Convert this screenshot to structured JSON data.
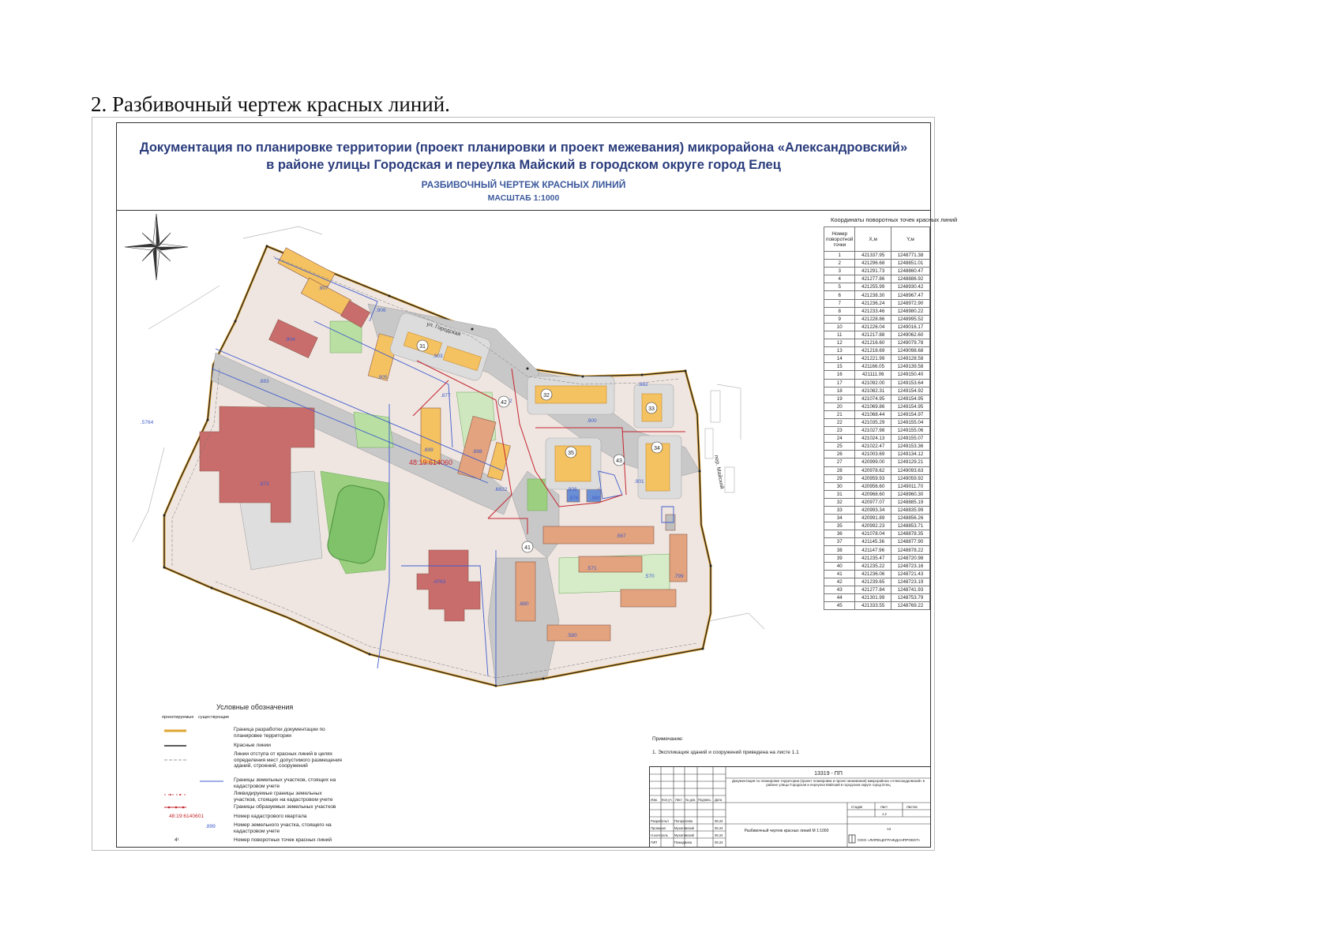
{
  "heading": "2. Разбивочный чертеж красных линий.",
  "title": {
    "line1": "Документация по планировке территории (проект планировки и проект межевания) микрорайона «Александровский»",
    "line2": "в районе улицы Городская и переулка Майский в городском округе город Елец",
    "subtitle": "РАЗБИВОЧНЫЙ ЧЕРТЕЖ КРАСНЫХ ЛИНИЙ",
    "scale": "МАСШТАБ 1:1000"
  },
  "map": {
    "cadastral_quarter": "48:19:614060",
    "street_1": "ул. Городская",
    "street_2": "пер. Майский",
    "parcel_labels": [
      ".907",
      ".906",
      ".904",
      ".905",
      ".903",
      ".877",
      ".902",
      ".899",
      ".898",
      ".6822",
      ".873",
      ".900",
      ".908",
      ".901",
      ".976",
      ".980",
      ".567",
      ".571",
      ".570",
      ".799",
      ".4763",
      ".880",
      ".580",
      ".5764",
      ".882",
      ".883"
    ],
    "zone_numbers": [
      "31",
      "32",
      "33",
      "34",
      "35",
      "41",
      "42",
      "43"
    ]
  },
  "coordinates": {
    "title": "Координаты поворотных точек красных линий",
    "headers": [
      "Номер поворотной точки",
      "X,м",
      "Y,м"
    ],
    "rows": [
      [
        "1",
        "421337.95",
        "1248771.38"
      ],
      [
        "2",
        "421296.68",
        "1248851.01"
      ],
      [
        "3",
        "421291.73",
        "1248860.47"
      ],
      [
        "4",
        "421277.86",
        "1248886.92"
      ],
      [
        "5",
        "421255.99",
        "1248930.42"
      ],
      [
        "6",
        "421238.30",
        "1248967.47"
      ],
      [
        "7",
        "421236.24",
        "1248972.90"
      ],
      [
        "8",
        "421233.46",
        "1248980.22"
      ],
      [
        "9",
        "421228.86",
        "1248995.52"
      ],
      [
        "10",
        "421226.04",
        "1249016.17"
      ],
      [
        "11",
        "421217.88",
        "1249062.60"
      ],
      [
        "12",
        "421216.60",
        "1249079.78"
      ],
      [
        "13",
        "421218.69",
        "1249098.68"
      ],
      [
        "14",
        "421221.99",
        "1249128.58"
      ],
      [
        "15",
        "421166.05",
        "1249139.58"
      ],
      [
        "16",
        "421111.06",
        "1249150.40"
      ],
      [
        "17",
        "421092.00",
        "1249153.64"
      ],
      [
        "18",
        "421082.31",
        "1249154.92"
      ],
      [
        "19",
        "421074.95",
        "1249154.95"
      ],
      [
        "20",
        "421069.86",
        "1249154.95"
      ],
      [
        "21",
        "421068.44",
        "1249154.97"
      ],
      [
        "22",
        "421035.29",
        "1249155.04"
      ],
      [
        "23",
        "421027.98",
        "1249155.06"
      ],
      [
        "24",
        "421024.13",
        "1249155.07"
      ],
      [
        "25",
        "421022.47",
        "1249153.36"
      ],
      [
        "26",
        "421003.69",
        "1249134.12"
      ],
      [
        "27",
        "420999.00",
        "1249129.21"
      ],
      [
        "28",
        "420978.62",
        "1249093.63"
      ],
      [
        "29",
        "420959.93",
        "1249059.92"
      ],
      [
        "30",
        "420956.60",
        "1249011.70"
      ],
      [
        "31",
        "420968.60",
        "1248960.30"
      ],
      [
        "32",
        "420977.07",
        "1248885.19"
      ],
      [
        "33",
        "420993.34",
        "1248835.99"
      ],
      [
        "34",
        "420991.89",
        "1248856.26"
      ],
      [
        "35",
        "420992.23",
        "1248853.71"
      ],
      [
        "36",
        "421078.04",
        "1248878.35"
      ],
      [
        "37",
        "421145.36",
        "1248877.90"
      ],
      [
        "38",
        "421147.96",
        "1248878.22"
      ],
      [
        "39",
        "421235.47",
        "1248720.98"
      ],
      [
        "40",
        "421235.22",
        "1248723.16"
      ],
      [
        "41",
        "421236.06",
        "1248721.43"
      ],
      [
        "42",
        "421239.65",
        "1248723.19"
      ],
      [
        "43",
        "421277.84",
        "1248741.93"
      ],
      [
        "44",
        "421301.99",
        "1248753.79"
      ],
      [
        "45",
        "421333.55",
        "1248769.22"
      ]
    ]
  },
  "legend": {
    "title": "Условные обозначения",
    "col_proposed": "проектируемые",
    "col_existing": "существующие",
    "items": [
      "Граница разработки документации по планировке территории",
      "Красные линии",
      "Линии отступа от красных линий в целях определения мест допустимого размещения зданий, строений, сооружений",
      "Границы земельных участков, стоящих на кадастровом учете",
      "Ликвидируемые границы земельных участков, стоящих на кадастровом учете",
      "Границы образуемых земельных участков",
      "Номер кадастрового квартала",
      "Номер земельного участка, стоящего на кадастровом учете",
      "Номер поворотных точек красных линий"
    ],
    "sample_quarter": "48:19:6140601",
    "sample_parcel": ".899",
    "sample_point": "4¹"
  },
  "notes": {
    "title": "Примечание:",
    "item1": "1. Экспликация зданий и сооружений приведена на листе 1.1"
  },
  "stamp": {
    "code": "13319 - ПП",
    "description": "Документация по планировке территории (проект планировки и проект межевания) микрорайона «Александровский» в районе улицы Городская и переулка Майский в городском округе город Елец",
    "columns": [
      "Изм.",
      "Кол.уч.",
      "Лист",
      "№ док.",
      "Подпись",
      "Дата"
    ],
    "roles": [
      "Разработал",
      "Проверил",
      "Н.контроль",
      "ГИП"
    ],
    "names": [
      "Погорелова",
      "Мухатовский",
      "Мухатовский",
      "Пожидаева"
    ],
    "dates": [
      "06.24",
      "06.24",
      "06.24",
      "06.24"
    ],
    "stage_headers": [
      "Стадия",
      "Лист",
      "Листов"
    ],
    "sheet": "1.2",
    "format": "А3",
    "drawing_name": "Разбивочный чертеж красных линий М 1:1000",
    "company": "ООО «ЛИПЕЦКГРАЖДАНПРОЕКТ»"
  },
  "colors": {
    "boundary": "#e0a431",
    "red_line": "#222222",
    "new_parcel": "#c4262e",
    "existing_parcel": "#3f5ccc",
    "building": "#e2a37e",
    "building_alt": "#c96c6c",
    "new_building": "#f5c262",
    "green": "#9ccf7f",
    "road": "#c8c8c8"
  }
}
